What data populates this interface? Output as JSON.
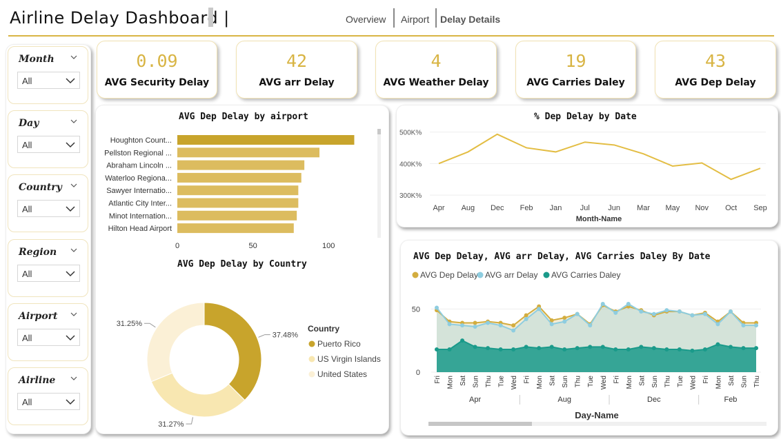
{
  "header": {
    "title": "Airline Delay Dashboard |",
    "nav": [
      "Overview",
      "Airport",
      "Delay Details"
    ]
  },
  "slicers": [
    {
      "label": "Month",
      "value": "All"
    },
    {
      "label": "Day",
      "value": "All"
    },
    {
      "label": "Country",
      "value": "All"
    },
    {
      "label": "Region",
      "value": "All"
    },
    {
      "label": "Airport",
      "value": "All"
    },
    {
      "label": "Airline",
      "value": "All"
    }
  ],
  "kpis": [
    {
      "value": "0.09",
      "label": "AVG Security Delay"
    },
    {
      "value": "42",
      "label": "AVG arr Delay"
    },
    {
      "value": "4",
      "label": "AVG Weather Delay"
    },
    {
      "value": "19",
      "label": "AVG Carries Daley"
    },
    {
      "value": "43",
      "label": "AVG Dep Delay"
    }
  ],
  "colors": {
    "accent": "#d8b443",
    "gold": "#c8a42c",
    "teal": "#1a9a8a",
    "lightblue": "#8ecde0",
    "cream": "#f7e6b3"
  },
  "chart_data": [
    {
      "type": "bar",
      "title": "AVG Dep Delay by airport",
      "orientation": "horizontal",
      "categories": [
        "Houghton Count...",
        "Pellston Regional ...",
        "Abraham Lincoln ...",
        "Waterloo Regiona...",
        "Sawyer Internatio...",
        "Atlantic City Inter...",
        "Minot Internation...",
        "Hilton Head Airport"
      ],
      "values": [
        117,
        94,
        84,
        82,
        80,
        80,
        79,
        77
      ],
      "xticks": [
        0,
        50,
        100
      ],
      "xlim": [
        0,
        125
      ]
    },
    {
      "type": "line",
      "title": "% Dep Delay by Date",
      "xlabel": "Month-Name",
      "categories": [
        "Apr",
        "Aug",
        "Dec",
        "Feb",
        "Jan",
        "Jul",
        "Jun",
        "Mar",
        "May",
        "Nov",
        "Oct",
        "Sep"
      ],
      "values": [
        400,
        437,
        493,
        450,
        437,
        468,
        459,
        431,
        392,
        402,
        350,
        385
      ],
      "yticks": [
        "300K%",
        "400K%",
        "500K%"
      ],
      "ylim": [
        285,
        510
      ]
    },
    {
      "type": "pie",
      "title": "AVG Dep Delay by Country",
      "legend_title": "Country",
      "labels": [
        "Puerto Rico",
        "US Virgin Islands",
        "United States"
      ],
      "values": [
        37.48,
        31.27,
        31.25
      ],
      "value_labels": [
        "37.48%",
        "31.27%",
        "31.25%"
      ],
      "colors": [
        "#c8a42c",
        "#f8e7b1",
        "#fbf0d6"
      ]
    },
    {
      "type": "area",
      "title": "AVG Dep Delay, AVG arr Delay, AVG Carries Daley By Date",
      "xlabel": "Day-Name",
      "days": [
        "Fri",
        "Mon",
        "Sat",
        "Sun",
        "Thu",
        "Tue",
        "Wed",
        "Fri",
        "Mon",
        "Sat",
        "Sun",
        "Thu",
        "Tue",
        "Wed",
        "Fri",
        "Mon",
        "Sat",
        "Sun",
        "Thu",
        "Tue",
        "Wed",
        "Fri",
        "Mon",
        "Sat",
        "Sun",
        "Thu"
      ],
      "months": [
        "Apr",
        "Aug",
        "Dec",
        "Feb"
      ],
      "yticks": [
        0,
        50
      ],
      "ylim": [
        0,
        60
      ],
      "series": [
        {
          "name": "AVG Dep Delay",
          "color": "#d3ad3f",
          "values": [
            49,
            40,
            39,
            39,
            40,
            39,
            37,
            45,
            52,
            41,
            43,
            46,
            38,
            53,
            48,
            52,
            49,
            45,
            48,
            48,
            45,
            47,
            40,
            48,
            39,
            39
          ]
        },
        {
          "name": "AVG arr Delay",
          "color": "#8ecde0",
          "values": [
            51,
            38,
            37,
            36,
            39,
            37,
            33,
            42,
            50,
            38,
            40,
            46,
            37,
            54,
            47,
            54,
            48,
            46,
            49,
            48,
            45,
            46,
            38,
            48,
            37,
            37
          ]
        },
        {
          "name": "AVG Carries Daley",
          "color": "#1a9a8a",
          "values": [
            18,
            18,
            25,
            20,
            19,
            18,
            18,
            20,
            19,
            20,
            18,
            19,
            20,
            20,
            18,
            18,
            20,
            19,
            18,
            18,
            17,
            18,
            22,
            20,
            19,
            19
          ]
        }
      ]
    }
  ]
}
